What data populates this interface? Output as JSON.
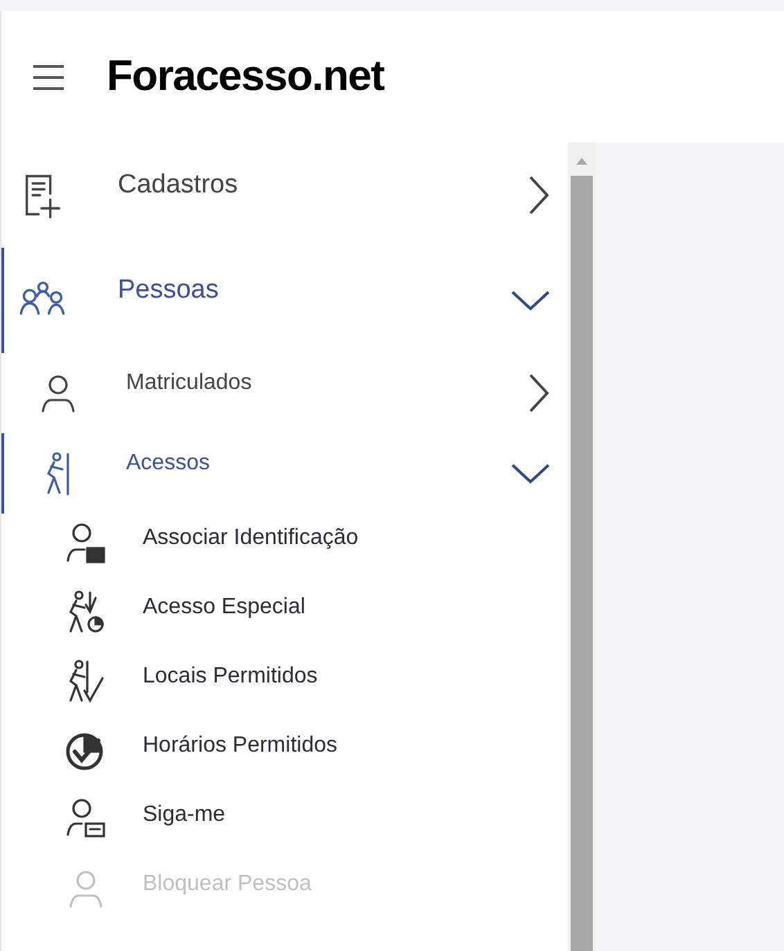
{
  "header": {
    "title": "Foracesso.net"
  },
  "menu": [
    {
      "label": "Cadastros",
      "kind": "form",
      "selected": false,
      "expanded": false
    },
    {
      "label": "Pessoas",
      "kind": "people",
      "selected": true,
      "expanded": true,
      "children": [
        {
          "label": "Matriculados",
          "kind": "person",
          "selected": false,
          "expanded": false
        },
        {
          "label": "Acessos",
          "kind": "walker",
          "selected": true,
          "expanded": true,
          "children": [
            {
              "label": "Associar Identificação",
              "kind": "person-card",
              "disabled": false
            },
            {
              "label": "Acesso Especial",
              "kind": "walker-clock",
              "disabled": false
            },
            {
              "label": "Locais Permitidos",
              "kind": "walker-check",
              "disabled": false
            },
            {
              "label": "Horários Permitidos",
              "kind": "clock-check",
              "disabled": false
            },
            {
              "label": "Siga-me",
              "kind": "person-chat",
              "disabled": false
            },
            {
              "label": "Bloquear Pessoa",
              "kind": "person",
              "disabled": true
            }
          ]
        }
      ]
    }
  ]
}
